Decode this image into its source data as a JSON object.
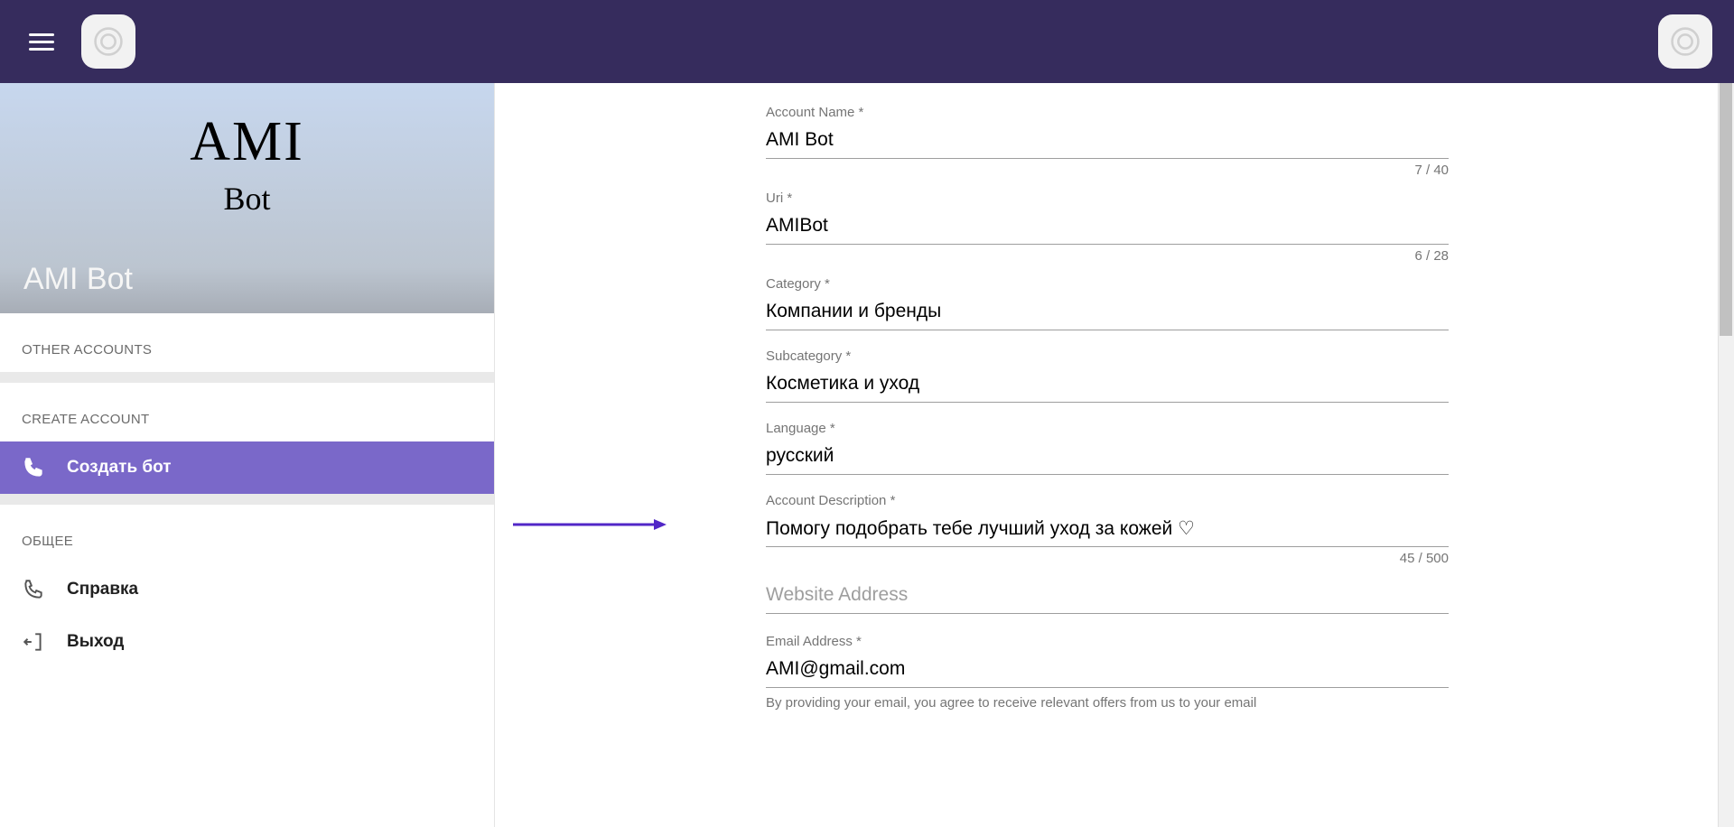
{
  "colors": {
    "topbar": "#362c5d",
    "accent": "#7a68c9",
    "arrow": "#5127c7"
  },
  "sidebar": {
    "profile": {
      "big_text": "AMI",
      "small_text": "Bot",
      "overlay_title": "AMI Bot"
    },
    "sections": {
      "other_accounts_label": "OTHER ACCOUNTS",
      "create_account_label": "CREATE ACCOUNT",
      "general_label": "ОБЩЕЕ"
    },
    "items": {
      "create_bot": "Создать бот",
      "help": "Справка",
      "logout": "Выход"
    }
  },
  "form": {
    "account_name": {
      "label": "Account Name *",
      "value": "AMI Bot",
      "counter": "7 / 40"
    },
    "uri": {
      "label": "Uri *",
      "value": "AMIBot",
      "counter": "6 / 28"
    },
    "category": {
      "label": "Category *",
      "value": "Компании и бренды"
    },
    "subcategory": {
      "label": "Subcategory *",
      "value": "Косметика и уход"
    },
    "language": {
      "label": "Language *",
      "value": "русский"
    },
    "description": {
      "label": "Account Description *",
      "value": "Помогу подобрать тебе лучший уход за кожей ♡",
      "counter": "45 / 500"
    },
    "website": {
      "placeholder": "Website Address",
      "value": ""
    },
    "email": {
      "label": "Email Address *",
      "value": "AMI@gmail.com",
      "helper": "By providing your email, you agree to receive relevant offers from us to your email"
    }
  }
}
